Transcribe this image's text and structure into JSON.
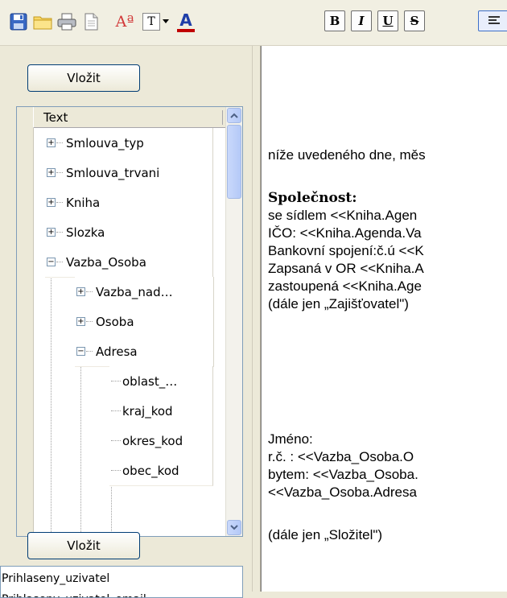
{
  "toolbar": {
    "icons": [
      "save-icon",
      "open-folder-icon",
      "print-icon",
      "new-document-icon",
      "font-size-icon",
      "text-style-icon",
      "dropdown-arrow-icon",
      "font-color-icon"
    ],
    "bold_label": "B",
    "italic_label": "I",
    "underline_label": "U",
    "strike_label": "S",
    "font_size_glyph": "Aª",
    "text_style_glyph": "T",
    "font_color_glyph": "A",
    "font_color": "#1f3ea8",
    "underline_color": "#c00000"
  },
  "left_panel": {
    "insert_top_label": "Vložit",
    "insert_bottom_label": "Vložit",
    "tree_header": "Text",
    "tree_items": [
      {
        "label": "Smlouva_typ",
        "expander": "+"
      },
      {
        "label": "Smlouva_trvani",
        "expander": "+"
      },
      {
        "label": "Kniha",
        "expander": "+"
      },
      {
        "label": "Slozka",
        "expander": "+"
      },
      {
        "label": "Vazba_Osoba",
        "expander": "−"
      },
      {
        "label": "Vazba_nad…",
        "expander": "+"
      },
      {
        "label": "Osoba",
        "expander": "+"
      },
      {
        "label": "Adresa",
        "expander": "−"
      },
      {
        "label": "oblast_…",
        "expander": ""
      },
      {
        "label": "kraj_kod",
        "expander": ""
      },
      {
        "label": "okres_kod",
        "expander": ""
      },
      {
        "label": "obec_kod",
        "expander": ""
      }
    ],
    "variables": [
      "Prihlaseny_uzivatel",
      "Prihlaseny_uzivatel_email"
    ]
  },
  "editor": {
    "lines": [
      "níže uvedeného dne, měs",
      "Společnost:",
      "se sídlem <<Kniha.Agen",
      "IČO: <<Kniha.Agenda.Va",
      "Bankovní spojení:č.ú <<K",
      "Zapsaná v OR <<Kniha.A",
      "zastoupená <<Kniha.Age",
      " (dále jen „Zajišťovatel\")",
      "Jméno:",
      "r.č. : <<Vazba_Osoba.O",
      "bytem: <<Vazba_Osoba.",
      "<<Vazba_Osoba.Adresa",
      "(dále jen „Složitel\")"
    ]
  }
}
